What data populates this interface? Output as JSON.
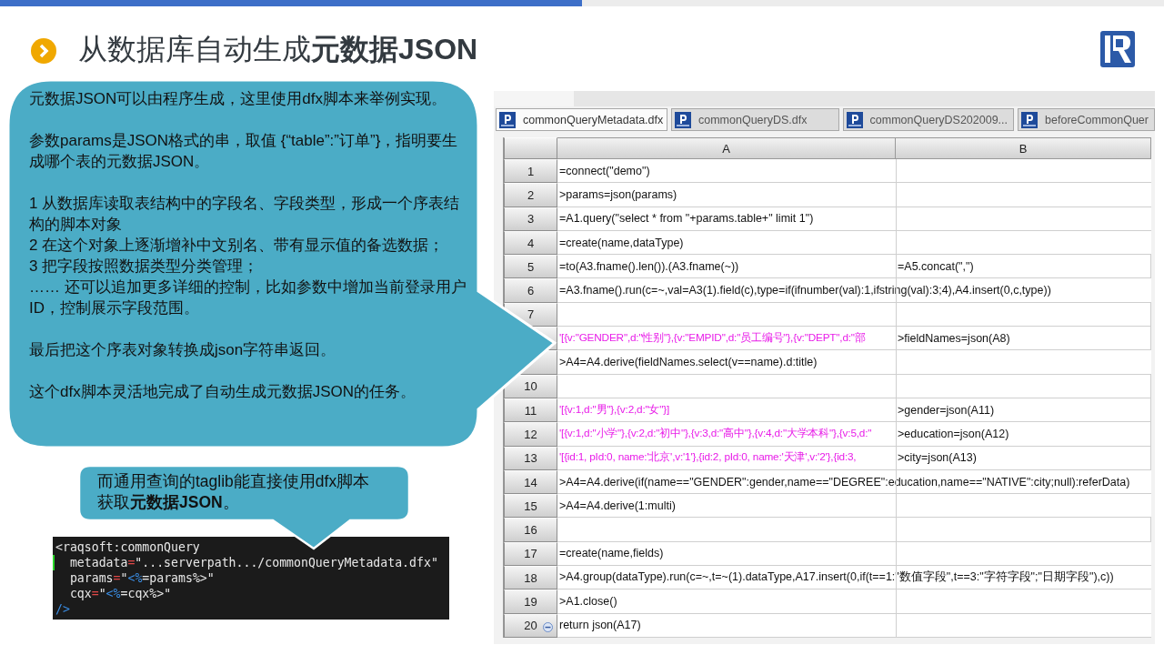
{
  "slide": {
    "title": "从数据库自动生成**元数据JSON**"
  },
  "callout": {
    "paragraphs": [
      {
        "lines": [
          "元数据JSON可以由程序生成，这里使用dfx脚本来举例实现。"
        ]
      },
      {
        "lines": [
          "参数params是JSON格式的串，取值 {“table”:”订单”}，指明要生成哪个表的元数据JSON。"
        ]
      },
      {
        "lines": [
          "1 从数据库读取表结构中的字段名、字段类型，形成一个序表结构的脚本对象",
          "2 在这个对象上逐渐增补中文别名、带有显示值的备选数据；",
          "3 把字段按照数据类型分类管理；",
          "…… 还可以追加更多详细的控制，比如参数中增加当前登录用户ID，控制展示字段范围。"
        ]
      },
      {
        "lines": [
          "最后把这个序表对象转换成json字符串返回。"
        ]
      },
      {
        "lines": [
          "这个dfx脚本灵活地完成了自动生成元数据JSON的任务。"
        ]
      }
    ]
  },
  "note": {
    "text": "而通用查询的taglib能直接使用dfx脚本获取**元数据JSON**。"
  },
  "code_block": {
    "lines": [
      {
        "marked": false,
        "segments": [
          {
            "kind": "plain",
            "text": "<raqsoft:commonQuery"
          }
        ]
      },
      {
        "marked": true,
        "segments": [
          {
            "kind": "plain",
            "text": "  metadata"
          },
          {
            "kind": "op",
            "text": "="
          },
          {
            "kind": "plain",
            "text": "\"...serverpath.../commonQueryMetadata.dfx\""
          }
        ]
      },
      {
        "marked": false,
        "segments": [
          {
            "kind": "plain",
            "text": "  params"
          },
          {
            "kind": "op",
            "text": "="
          },
          {
            "kind": "plain",
            "text": "\""
          },
          {
            "kind": "delim",
            "text": "<%"
          },
          {
            "kind": "plain",
            "text": "=params%>\""
          }
        ]
      },
      {
        "marked": false,
        "segments": [
          {
            "kind": "plain",
            "text": "  cqx"
          },
          {
            "kind": "op",
            "text": "="
          },
          {
            "kind": "plain",
            "text": "\""
          },
          {
            "kind": "delim",
            "text": "<%"
          },
          {
            "kind": "plain",
            "text": "=cqx%>\""
          }
        ]
      },
      {
        "marked": false,
        "segments": [
          {
            "kind": "delim",
            "text": "/>"
          }
        ]
      }
    ]
  },
  "editor": {
    "tabs": [
      {
        "label": "commonQueryMetadata.dfx",
        "selected": true
      },
      {
        "label": "commonQueryDS.dfx",
        "selected": false
      },
      {
        "label": "commonQueryDS202009...",
        "selected": false
      },
      {
        "label": "beforeCommonQuer",
        "selected": false
      }
    ],
    "columns": [
      "A",
      "B"
    ],
    "rows": [
      {
        "number": "1",
        "a": {
          "kind": "formula",
          "text": "=connect(\"demo\")"
        }
      },
      {
        "number": "2",
        "a": {
          "kind": "formula",
          "text": ">params=json(params)"
        }
      },
      {
        "number": "3",
        "a": {
          "kind": "formula",
          "text": "=A1.query(\"select * from \"+params.table+\" limit 1\")"
        }
      },
      {
        "number": "4",
        "a": {
          "kind": "formula",
          "text": "=create(name,dataType)"
        }
      },
      {
        "number": "5",
        "a": {
          "kind": "formula",
          "text": "=to(A3.fname().len()).(A3.fname(~))"
        },
        "b": {
          "kind": "formula",
          "text": "=A5.concat(\",\")"
        }
      },
      {
        "number": "6",
        "a": {
          "kind": "formula",
          "text": "=A3.fname().run(c=~,val=A3(1).field(c),type=if(ifnumber(val):1,ifstring(val):3;4),A4.insert(0,c,type))"
        }
      },
      {
        "number": "7"
      },
      {
        "a": {
          "kind": "constant",
          "text": "'[{v:\"GENDER\",d:\"性别\"},{v:\"EMPID\",d:\"员工编号\"},{v:\"DEPT\",d:\"部"
        },
        "b": {
          "kind": "formula",
          "text": ">fieldNames=json(A8)"
        }
      },
      {
        "a": {
          "kind": "formula",
          "text": ">A4=A4.derive(fieldNames.select(v==name).d:title)"
        }
      },
      {
        "number": "10"
      },
      {
        "number": "11",
        "a": {
          "kind": "constant",
          "text": "'[{v:1,d:\"男\"},{v:2,d:\"女\"}]"
        },
        "b": {
          "kind": "formula",
          "text": ">gender=json(A11)"
        }
      },
      {
        "number": "12",
        "a": {
          "kind": "constant",
          "text": "'[{v:1,d:\"小学\"},{v:2,d:\"初中\"},{v:3,d:\"高中\"},{v:4,d:\"大学本科\"},{v:5,d:\""
        },
        "b": {
          "kind": "formula",
          "text": ">education=json(A12)"
        }
      },
      {
        "number": "13",
        "a": {
          "kind": "constant",
          "text": "'[{id:1, pId:0, name:'北京',v:'1'},{id:2, pId:0, name:'天津',v:'2'},{id:3,"
        },
        "b": {
          "kind": "formula",
          "text": ">city=json(A13)"
        }
      },
      {
        "number": "14",
        "a": {
          "kind": "formula",
          "text": ">A4=A4.derive(if(name==\"GENDER\":gender,name==\"DEGREE\":education,name==\"NATIVE\":city;null):referData)"
        }
      },
      {
        "number": "15",
        "a": {
          "kind": "formula",
          "text": ">A4=A4.derive(1:multi)"
        }
      },
      {
        "number": "16"
      },
      {
        "number": "17",
        "a": {
          "kind": "formula",
          "text": "=create(name,fields)"
        }
      },
      {
        "number": "18",
        "a": {
          "kind": "formula",
          "text": ">A4.group(dataType).run(c=~,t=~(1).dataType,A17.insert(0,if(t==1:\"数值字段\",t==3:\"字符字段\";\"日期字段\"),c))"
        }
      },
      {
        "number": "19",
        "a": {
          "kind": "formula",
          "text": ">A1.close()"
        }
      },
      {
        "number": "20",
        "expanded": true,
        "a": {
          "kind": "formula",
          "text": "return json(A17)"
        }
      }
    ]
  }
}
